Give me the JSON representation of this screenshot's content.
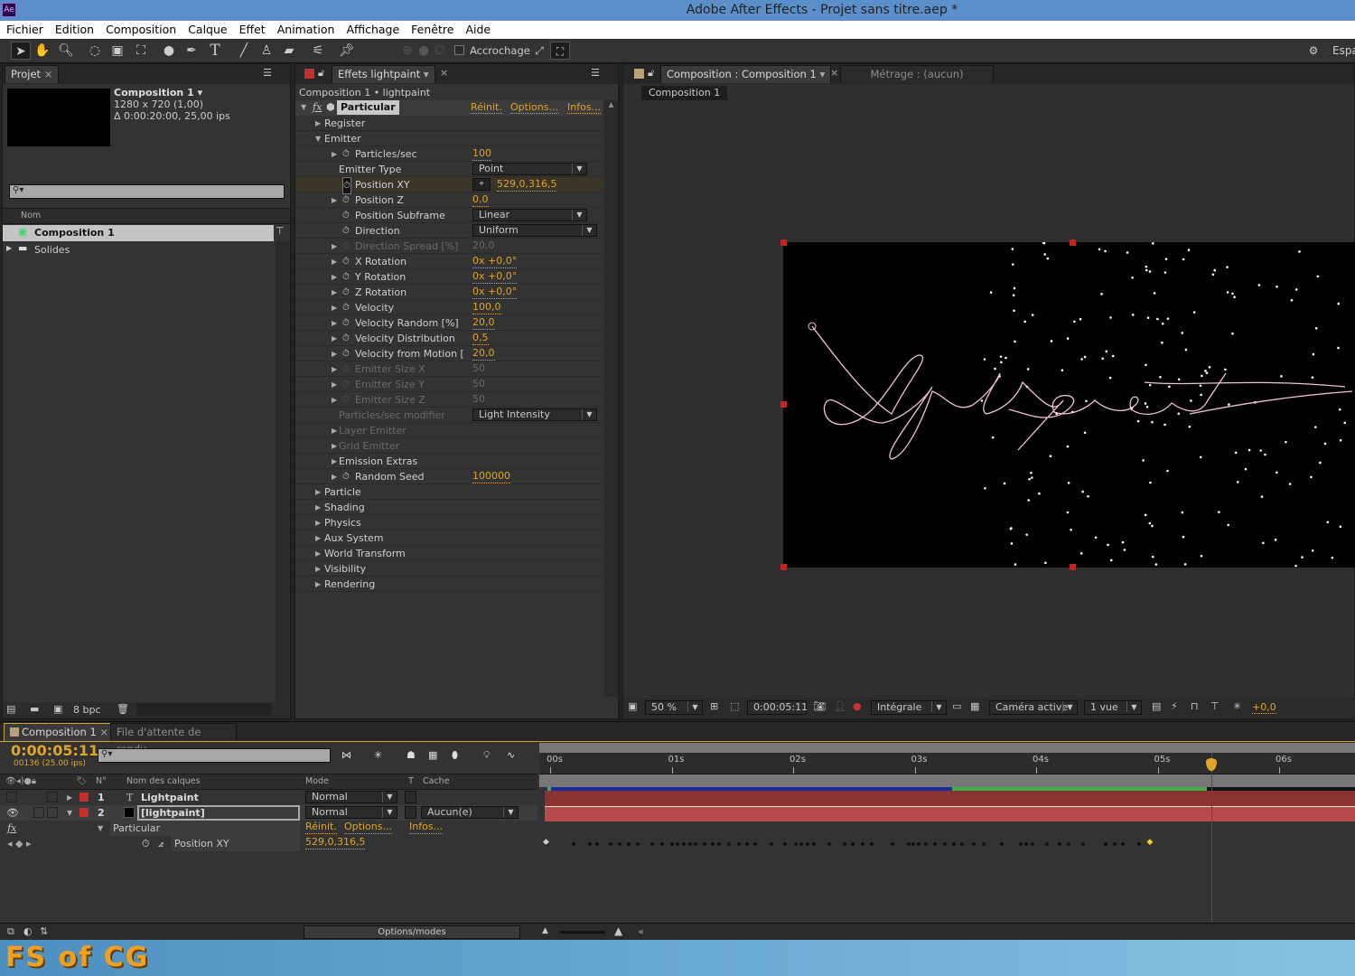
{
  "window": {
    "title": "Adobe After Effects - Projet sans titre.aep *",
    "app_icon": "Ae"
  },
  "menu": [
    "Fichier",
    "Edition",
    "Composition",
    "Calque",
    "Effet",
    "Animation",
    "Affichage",
    "Fenêtre",
    "Aide"
  ],
  "toolbar": {
    "snapping_label": "Accrochage",
    "workspace_label": "Espa",
    "tools": [
      "selection-tool",
      "hand-tool",
      "zoom-tool",
      "rotation-tool",
      "camera-tool",
      "pan-behind-tool",
      "ellipse-tool",
      "pen-tool",
      "text-tool",
      "brush-tool",
      "clone-stamp-tool",
      "eraser-tool",
      "roto-brush-tool",
      "puppet-pin-tool"
    ]
  },
  "project": {
    "tab": "Projet",
    "selected": {
      "name": "Composition 1",
      "resolution": "1280 x 720 (1,00)",
      "duration": "Δ 0:00:20:00, 25,00 ips"
    },
    "search_placeholder": "",
    "column_name": "Nom",
    "items": [
      {
        "name": "Composition 1",
        "type": "composition",
        "selected": true
      },
      {
        "name": "Solides",
        "type": "folder",
        "selected": false
      }
    ],
    "bpc": "8 bpc"
  },
  "effects": {
    "tab": "Effets lightpaint",
    "breadcrumb": "Composition 1 • lightpaint",
    "effect_name": "Particular",
    "reset": "Réinit.",
    "options": "Options...",
    "about": "Infos...",
    "rows": [
      {
        "indent": 1,
        "tri": "right",
        "label": "Register"
      },
      {
        "indent": 1,
        "tri": "down",
        "label": "Emitter"
      },
      {
        "indent": 2,
        "tri": "right",
        "stopwatch": true,
        "label": "Particles/sec",
        "value": "100"
      },
      {
        "indent": 2,
        "label": "Emitter Type",
        "dropdown": "Point"
      },
      {
        "indent": 2,
        "stopwatch": true,
        "active": true,
        "label": "Position XY",
        "value": "529,0,316,5",
        "crosshair": true
      },
      {
        "indent": 2,
        "tri": "right",
        "stopwatch": true,
        "label": "Position Z",
        "value": "0,0"
      },
      {
        "indent": 2,
        "stopwatch": true,
        "label": "Position Subframe",
        "dropdown": "Linear"
      },
      {
        "indent": 2,
        "stopwatch": true,
        "label": "Direction",
        "dropdown": "Uniform"
      },
      {
        "indent": 2,
        "tri": "right",
        "stopwatch": true,
        "label": "Direction Spread [%]",
        "value": "20,0",
        "disabled": true
      },
      {
        "indent": 2,
        "tri": "right",
        "stopwatch": true,
        "label": "X Rotation",
        "value": "0x +0,0°"
      },
      {
        "indent": 2,
        "tri": "right",
        "stopwatch": true,
        "label": "Y Rotation",
        "value": "0x +0,0°"
      },
      {
        "indent": 2,
        "tri": "right",
        "stopwatch": true,
        "label": "Z Rotation",
        "value": "0x +0,0°"
      },
      {
        "indent": 2,
        "tri": "right",
        "stopwatch": true,
        "label": "Velocity",
        "value": "100,0"
      },
      {
        "indent": 2,
        "tri": "right",
        "stopwatch": true,
        "label": "Velocity Random [%]",
        "value": "20,0"
      },
      {
        "indent": 2,
        "tri": "right",
        "stopwatch": true,
        "label": "Velocity Distribution",
        "value": "0,5"
      },
      {
        "indent": 2,
        "tri": "right",
        "stopwatch": true,
        "label": "Velocity from Motion [",
        "value": "20,0"
      },
      {
        "indent": 2,
        "tri": "right",
        "stopwatch": true,
        "label": "Emitter Size X",
        "value": "50",
        "disabled": true
      },
      {
        "indent": 2,
        "tri": "right",
        "stopwatch": true,
        "label": "Emitter Size Y",
        "value": "50",
        "disabled": true
      },
      {
        "indent": 2,
        "tri": "right",
        "stopwatch": true,
        "label": "Emitter Size Z",
        "value": "50",
        "disabled": true
      },
      {
        "indent": 2,
        "label": "Particles/sec modifier",
        "dropdown": "Light Intensity",
        "disabled": true
      },
      {
        "indent": 2,
        "tri": "right",
        "label": "Layer Emitter",
        "disabled": true,
        "group": true
      },
      {
        "indent": 2,
        "tri": "right",
        "label": "Grid Emitter",
        "disabled": true,
        "group": true
      },
      {
        "indent": 2,
        "tri": "right",
        "label": "Emission Extras",
        "group": true
      },
      {
        "indent": 2,
        "tri": "right",
        "stopwatch": true,
        "label": "Random Seed",
        "value": "100000"
      },
      {
        "indent": 1,
        "tri": "right",
        "label": "Particle"
      },
      {
        "indent": 1,
        "tri": "right",
        "label": "Shading"
      },
      {
        "indent": 1,
        "tri": "right",
        "label": "Physics"
      },
      {
        "indent": 1,
        "tri": "right",
        "label": "Aux System"
      },
      {
        "indent": 1,
        "tri": "right",
        "label": "World Transform"
      },
      {
        "indent": 1,
        "tri": "right",
        "label": "Visibility"
      },
      {
        "indent": 1,
        "tri": "right",
        "label": "Rendering"
      }
    ]
  },
  "composition": {
    "tab": "Composition : Composition 1",
    "footage_tab": "Métrage : (aucun)",
    "flow_label": "Composition 1",
    "canvas_text": "Lightpaint",
    "footer": {
      "zoom": "50 %",
      "timecode": "0:00:05:11",
      "resolution": "Intégrale",
      "camera": "Caméra active",
      "views": "1 vue",
      "exposure": "+0,0"
    }
  },
  "timeline": {
    "tab": "Composition 1",
    "render_queue_tab": "File d'attente de rendu",
    "timecode": "0:00:05:11",
    "frame_info": "00136 (25.00 ips)",
    "columns": {
      "num": "N°",
      "name": "Nom des calques",
      "mode": "Mode",
      "t": "T",
      "matte": "Cache"
    },
    "layers": [
      {
        "num": "1",
        "name": "Lightpaint",
        "type": "text",
        "mode": "Normal",
        "matte": "",
        "color": "#c0302e"
      },
      {
        "num": "2",
        "name": "[lightpaint]",
        "type": "solid",
        "mode": "Normal",
        "matte": "Aucun(e)",
        "color": "#c0302e",
        "selected": true
      }
    ],
    "effect_row": {
      "name": "Particular",
      "reset": "Réinit.",
      "options": "Options...",
      "about": "Infos..."
    },
    "property_row": {
      "name": "Position XY",
      "value": "529,0,316,5"
    },
    "ruler": [
      "00s",
      "01s",
      "02s",
      "03s",
      "04s",
      "05s",
      "06s"
    ],
    "current_time_seconds": 5.44,
    "options_modes": "Options/modes"
  },
  "watermark": "FS of CG",
  "colors": {
    "accent": "#e0a526",
    "label_red": "#c0302e",
    "playhead": "#e01010",
    "titlebar": "#5b8fc9"
  }
}
